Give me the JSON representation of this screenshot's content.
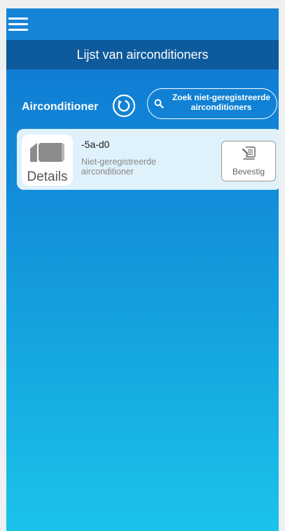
{
  "header": {
    "title": "Lijst van airconditioners",
    "menu_icon": "hamburger-menu-icon"
  },
  "toolbar": {
    "section_label": "Airconditioner",
    "refresh_icon": "refresh-icon",
    "search_button_label": "Zoek niet-geregistreerde airconditioners"
  },
  "devices": [
    {
      "name": "-5a-d0",
      "status": "Niet-geregistreerde airconditioner",
      "details_label": "Details",
      "confirm_label": "Bevestig"
    }
  ],
  "colors": {
    "primary": "#1684d6",
    "title_bar": "#0d5a9c",
    "card_background": "#dff1fb",
    "gradient_bottom": "#1bc3ea"
  }
}
